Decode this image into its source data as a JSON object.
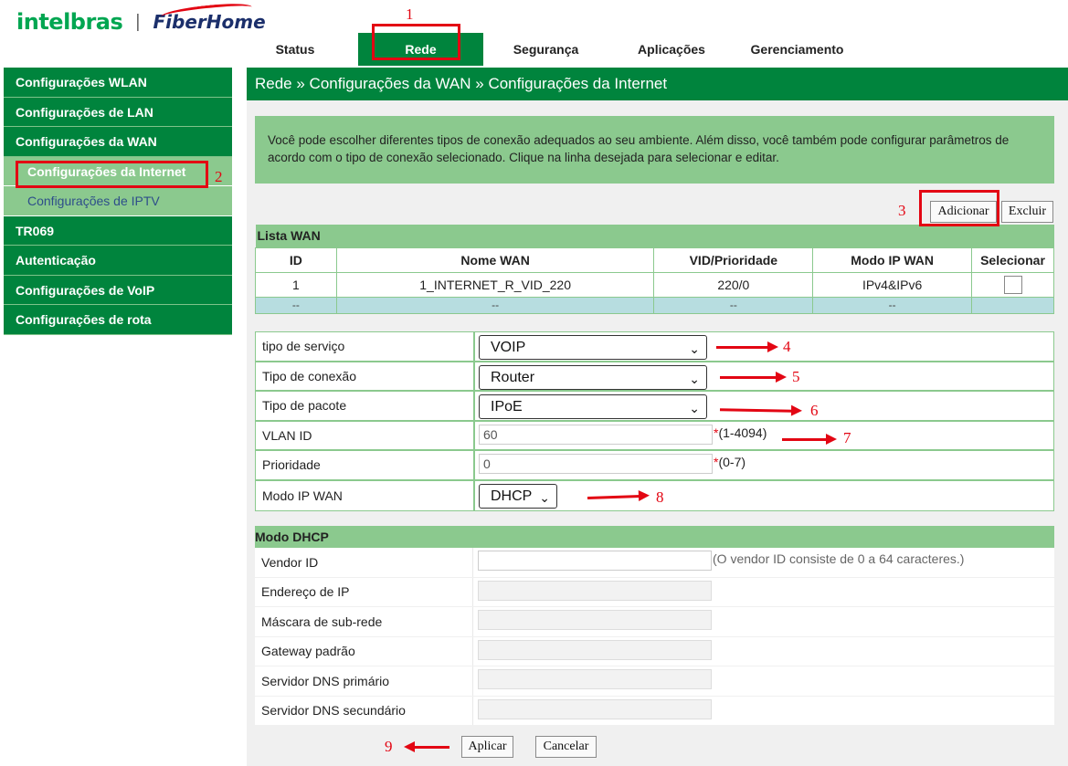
{
  "header": {
    "brand_primary": "intelbras",
    "brand_separator": "|",
    "brand_secondary": "FiberHome"
  },
  "topnav": {
    "tabs": [
      "Status",
      "Rede",
      "Segurança",
      "Aplicações",
      "Gerenciamento"
    ],
    "active": "Rede"
  },
  "sidebar": {
    "items": [
      "Configurações WLAN",
      "Configurações de LAN",
      "Configurações da WAN",
      "Configurações da Internet",
      "Configurações de IPTV",
      "TR069",
      "Autenticação",
      "Configurações de VoIP",
      "Configurações de rota"
    ],
    "active": "Configurações da Internet"
  },
  "breadcrumb": "Rede » Configurações da WAN » Configurações da Internet",
  "info_text": "Você pode escolher diferentes tipos de conexão adequados ao seu ambiente. Além disso, você também pode configurar parâmetros de acordo com o tipo de conexão selecionado. Clique na linha desejada para selecionar e editar.",
  "buttons": {
    "add": "Adicionar",
    "delete": "Excluir",
    "apply": "Aplicar",
    "cancel": "Cancelar"
  },
  "wan_list": {
    "caption": "Lista WAN",
    "columns": [
      "ID",
      "Nome WAN",
      "VID/Prioridade",
      "Modo IP WAN",
      "Selecionar"
    ],
    "rows": [
      {
        "id": "1",
        "name": "1_INTERNET_R_VID_220",
        "vid": "220/0",
        "mode": "IPv4&IPv6"
      },
      {
        "id": "--",
        "name": "--",
        "vid": "--",
        "mode": "--"
      }
    ]
  },
  "form": {
    "service_type": {
      "label": "tipo de serviço",
      "value": "VOIP"
    },
    "connection_type": {
      "label": "Tipo de conexão",
      "value": "Router"
    },
    "packet_type": {
      "label": "Tipo de pacote",
      "value": "IPoE"
    },
    "vlan_id": {
      "label": "VLAN ID",
      "value": "60",
      "hint": "(1-4094)"
    },
    "priority": {
      "label": "Prioridade",
      "value": "0",
      "hint": "(0-7)"
    },
    "wan_ip_mode": {
      "label": "Modo IP WAN",
      "value": "DHCP"
    },
    "required_mark": "*"
  },
  "dhcp": {
    "caption": "Modo DHCP",
    "vendor_id": {
      "label": "Vendor ID",
      "value": "",
      "hint": "(O vendor ID consiste de 0 a 64 caracteres.)"
    },
    "ip_address": {
      "label": "Endereço de IP",
      "value": ""
    },
    "subnet_mask": {
      "label": "Máscara de sub-rede",
      "value": ""
    },
    "gateway": {
      "label": "Gateway padrão",
      "value": ""
    },
    "dns_primary": {
      "label": "Servidor DNS primário",
      "value": ""
    },
    "dns_secondary": {
      "label": "Servidor DNS secundário",
      "value": ""
    }
  },
  "annotations": [
    "1",
    "2",
    "3",
    "4",
    "5",
    "6",
    "7",
    "8",
    "9"
  ],
  "colors": {
    "brand_green": "#00843d",
    "light_green": "#8bc98e",
    "annotation_red": "#e30613"
  }
}
